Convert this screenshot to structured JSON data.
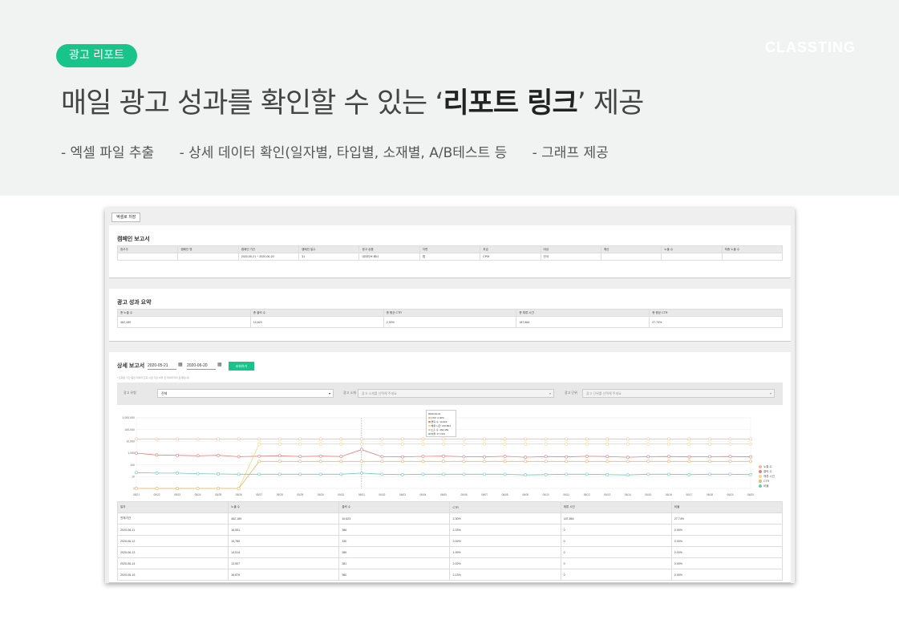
{
  "hero": {
    "badge": "광고 리포트",
    "brand": "CLASSTING",
    "headline_pre": "매일 광고 성과를 확인할 수 있는 ‘",
    "headline_bold": "리포트 링크",
    "headline_post": "’ 제공",
    "features": [
      "- 엑셀 파일 추출",
      "- 상세 데이터 확인(일자별, 타입별, 소재별, A/B테스트 등",
      "- 그래프 제공"
    ]
  },
  "colors": {
    "accent": "#19c48b",
    "hero_bg": "#f1f3f2"
  },
  "screenshot": {
    "excel_button": "엑셀로 저장",
    "campaign": {
      "title": "캠페인 보고서",
      "headers": [
        "광고주",
        "캠페인 명",
        "캠페인 기간",
        "캠페인 일수",
        "광고 상품",
        "지면",
        "과금",
        "대상",
        "예산",
        "노출 수",
        "최종 노출 수"
      ],
      "row": [
        "",
        "",
        "2020-05-21 ~ 2020-06-20",
        "31",
        "네이티브 배너",
        "앱",
        "CPM",
        "전국",
        "",
        "",
        ""
      ]
    },
    "summary": {
      "title": "광고 성과 요약",
      "headers": [
        "총 노출 수",
        "총 클릭 수",
        "총 평균 CTR",
        "총 체류 시간",
        "총 평균 CTR"
      ],
      "row": [
        "462,189",
        "10,623",
        "2.30%",
        "187,864",
        "27.74%"
      ]
    },
    "detail": {
      "title": "상세 보고서",
      "date_from": "2020-05-21",
      "date_to": "2020-06-20",
      "lookup_button": "조회하기",
      "note": "* 조회된 기간 동안 데이터 조회 시점 기준 하루 전 데이터까지 집계됩니다",
      "filter1_label": "광고 유형",
      "filter1_value": "전체",
      "filter2_label": "광고 소재",
      "filter2_value": "광고 소재를 선택해 주세요",
      "filter3_label": "광고 단위",
      "filter3_value": "광고 단위를 선택해 주세요",
      "table_headers": [
        "일자",
        "노출 수",
        "클릭 수",
        "CTR",
        "체류 시간",
        "비율"
      ],
      "table_rows": [
        [
          "전체기간",
          "462,189",
          "10,623",
          "2.30%",
          "187,864",
          "27.74%"
        ],
        [
          "2020-06-11",
          "16,591",
          "386",
          "2.33%",
          "0",
          "0.00%"
        ],
        [
          "2020-06-12",
          "15,780",
          "330",
          "2.09%",
          "0",
          "0.00%"
        ],
        [
          "2020-06-13",
          "14,514",
          "289",
          "1.99%",
          "0",
          "0.00%"
        ],
        [
          "2020-06-14",
          "13,907",
          "281",
          "2.02%",
          "0",
          "0.00%"
        ],
        [
          "2020-06-15",
          "16,876",
          "360",
          "2.13%",
          "0",
          "0.00%"
        ]
      ]
    }
  },
  "chart_data": {
    "type": "line",
    "x": [
      "05/21",
      "05/22",
      "05/23",
      "05/24",
      "05/25",
      "05/26",
      "05/27",
      "05/28",
      "05/29",
      "05/30",
      "05/31",
      "06/01",
      "06/02",
      "06/03",
      "06/04",
      "06/05",
      "06/06",
      "06/07",
      "06/08",
      "06/09",
      "06/10",
      "06/11",
      "06/12",
      "06/13",
      "06/14",
      "06/15",
      "06/16",
      "06/17",
      "06/18",
      "06/19",
      "06/20"
    ],
    "yscale": "log",
    "ylim": [
      1,
      1000000
    ],
    "yticks": [
      "1,000,000",
      "100,000",
      "10,000",
      "1,000",
      "100",
      "10",
      "1"
    ],
    "tooltip": {
      "date": "2020-06-01",
      "lines": [
        "CTR: 2.30%",
        "클릭 수: 10,623",
        "체류 시간: 187,864",
        "노출 수: 462,189",
        "비율: 27.74%"
      ]
    },
    "series": [
      {
        "name": "노출 수",
        "color": "#f3b9a0",
        "values": [
          16000,
          16000,
          16000,
          16000,
          16000,
          16000,
          16000,
          16000,
          16000,
          16000,
          16000,
          16000,
          16000,
          16000,
          16000,
          16000,
          16000,
          16000,
          16000,
          16000,
          16000,
          16000,
          16000,
          16000,
          16000,
          16000,
          16000,
          16000,
          16000,
          16000,
          16000
        ]
      },
      {
        "name": "클릭 수",
        "color": "#e87c7c",
        "values": [
          1000,
          700,
          650,
          600,
          650,
          500,
          550,
          600,
          520,
          560,
          520,
          2000,
          500,
          480,
          530,
          560,
          500,
          480,
          540,
          450,
          520,
          480,
          540,
          520,
          450,
          500,
          520,
          480,
          500,
          520,
          480
        ]
      },
      {
        "name": "체류 시간",
        "color": "#f5d77a",
        "values": [
          1,
          1,
          1,
          1,
          1,
          1,
          6000,
          6000,
          6000,
          6000,
          6000,
          6000,
          6000,
          6000,
          6000,
          6000,
          6000,
          6000,
          6000,
          6000,
          6000,
          6000,
          6000,
          6000,
          6000,
          6000,
          6000,
          6000,
          6000,
          6000,
          6000
        ]
      },
      {
        "name": "CTR",
        "color": "#e9b76a",
        "values": [
          1,
          1,
          1,
          1,
          1,
          1,
          200,
          200,
          200,
          200,
          200,
          200,
          200,
          200,
          200,
          200,
          200,
          200,
          200,
          200,
          200,
          200,
          200,
          200,
          200,
          200,
          200,
          200,
          200,
          200,
          200
        ]
      },
      {
        "name": "비율",
        "color": "#6cc9b5",
        "values": [
          22,
          20,
          20,
          18,
          17,
          16,
          16,
          16,
          16,
          16,
          16,
          20,
          16,
          15,
          16,
          16,
          16,
          16,
          16,
          14,
          15,
          16,
          16,
          15,
          14,
          16,
          16,
          15,
          16,
          16,
          15
        ]
      }
    ]
  }
}
